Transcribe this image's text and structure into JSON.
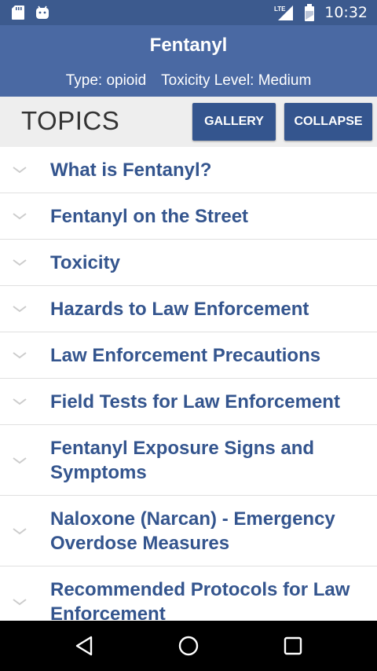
{
  "status_bar": {
    "time": "10:32",
    "network_label": "LTE",
    "left_icons": [
      "sd-card-icon",
      "android-notification-icon"
    ],
    "right_icons": [
      "signal-icon",
      "battery-icon"
    ]
  },
  "header": {
    "title": "Fentanyl",
    "type_text": "Type: opioid",
    "toxicity_text": "Toxicity Level: Medium",
    "background_color": "#4a69a3"
  },
  "topics_bar": {
    "title": "TOPICS",
    "gallery_label": "GALLERY",
    "collapse_label": "COLLAPSE"
  },
  "topics": [
    {
      "label": "What is Fentanyl?",
      "icon": "chevron-down-icon"
    },
    {
      "label": "Fentanyl on the Street",
      "icon": "chevron-down-icon"
    },
    {
      "label": "Toxicity",
      "icon": "chevron-down-icon"
    },
    {
      "label": "Hazards to Law Enforcement",
      "icon": "chevron-down-icon"
    },
    {
      "label": "Law Enforcement Precautions",
      "icon": "chevron-down-icon"
    },
    {
      "label": "Field Tests for Law Enforcement",
      "icon": "chevron-down-icon"
    },
    {
      "label": "Fentanyl Exposure Signs and Symptoms",
      "icon": "chevron-down-icon"
    },
    {
      "label": "Naloxone (Narcan) - Emergency Overdose Measures",
      "icon": "chevron-down-icon"
    },
    {
      "label": "Recommended Protocols for Law Enforcement",
      "icon": "chevron-down-icon"
    }
  ],
  "nav_bar": {
    "buttons": [
      "back-icon",
      "home-icon",
      "recents-icon"
    ]
  },
  "colors": {
    "accent": "#34558e",
    "status_bar": "#3c5a8e",
    "topics_background": "#eeeeee"
  }
}
